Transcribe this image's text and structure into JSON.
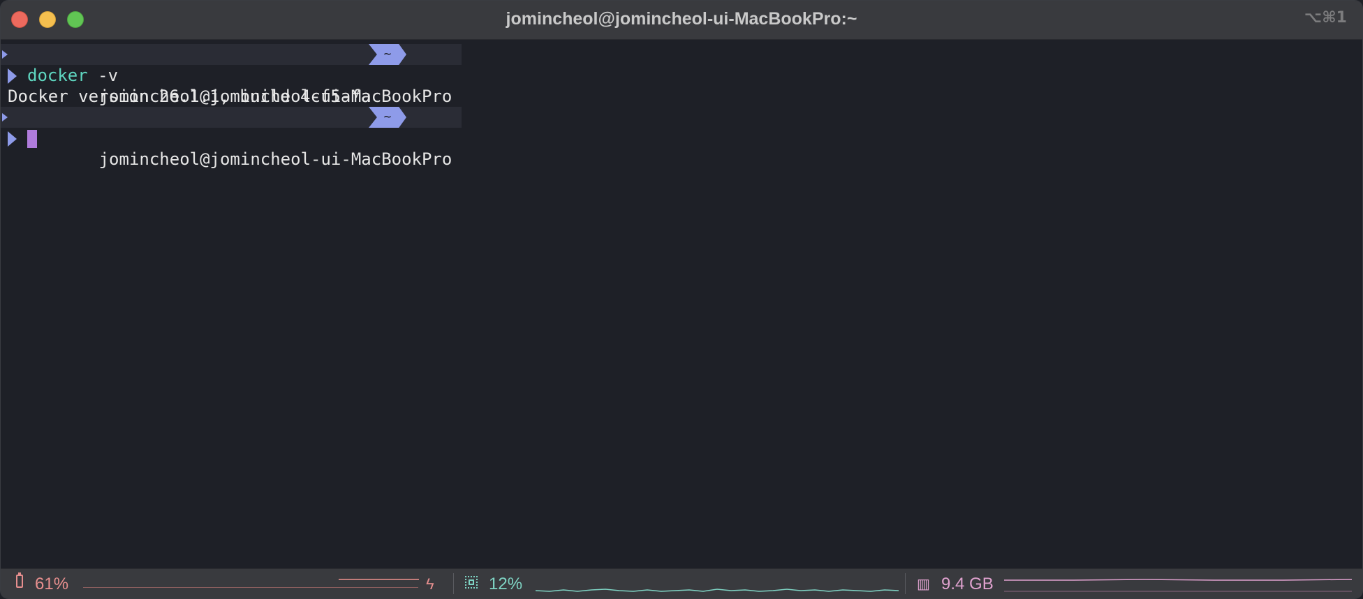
{
  "window": {
    "title": "jomincheol@jomincheol-ui-MacBookPro:~",
    "shortcut": "⌥⌘1"
  },
  "terminal": {
    "prompt1": {
      "user_host": "jomincheol@jomincheol-ui-MacBookPro",
      "dir": "~"
    },
    "command": {
      "exe": "docker",
      "args": " -v"
    },
    "output": "Docker version 26.1.1, build 4cf5afa",
    "prompt2": {
      "user_host": "jomincheol@jomincheol-ui-MacBookPro",
      "dir": "~"
    }
  },
  "statusbar": {
    "battery": {
      "icon": "battery-icon",
      "value": "61%",
      "charging_icon": "bolt-icon"
    },
    "cpu": {
      "icon": "cpu-icon",
      "value": "12%"
    },
    "memory": {
      "icon": "memory-icon",
      "value": "9.4 GB"
    }
  },
  "colors": {
    "prompt_accent": "#8e9be9",
    "command": "#5fd7c1",
    "cursor": "#b07cdc",
    "battery": "#e9908f",
    "cpu": "#7fd4c4",
    "memory": "#e0a2cf"
  }
}
